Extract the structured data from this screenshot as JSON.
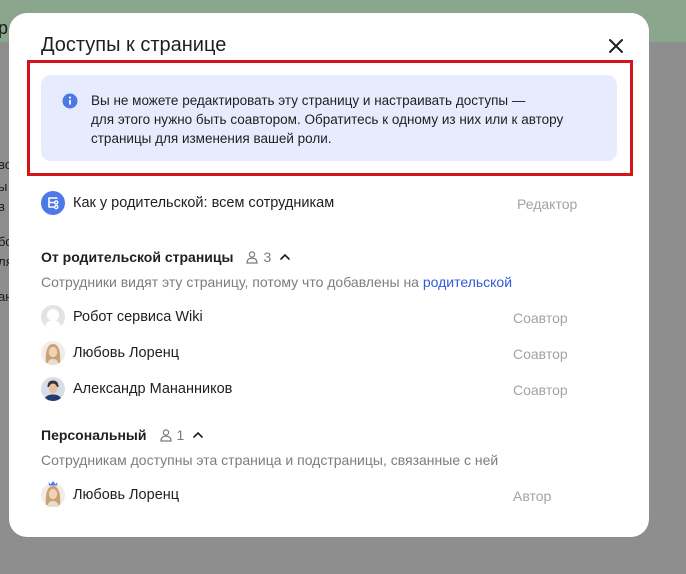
{
  "background": {
    "side_fragments": [
      "р",
      "во",
      "ы",
      "в",
      "бс",
      "ля",
      "ан"
    ]
  },
  "modal": {
    "title": "Доступы к странице",
    "notice": {
      "line1": "Вы не можете редактировать эту страницу и настраивать доступы —",
      "line2": "для этого нужно быть соавтором. Обратитесь к одному из них или к автору",
      "line3": "страницы для изменения вашей роли."
    },
    "inherit": {
      "label": "Как у родительской: всем сотрудникам",
      "role": "Редактор"
    },
    "parent_section": {
      "title": "От родительской страницы",
      "count": "3",
      "desc": "Сотрудники видят эту страницу, потому что добавлены на",
      "link": "родительской",
      "members": [
        {
          "name": "Робот сервиса Wiki",
          "role": "Соавтор",
          "avatar": "robot-avatar"
        },
        {
          "name": "Любовь Лоренц",
          "role": "Соавтор",
          "avatar": "woman-avatar"
        },
        {
          "name": "Александр Мананников",
          "role": "Соавтор",
          "avatar": "man-avatar"
        }
      ]
    },
    "personal_section": {
      "title": "Персональный",
      "count": "1",
      "desc": "Сотрудникам доступны эта страница и подстраницы, связанные с ней",
      "members": [
        {
          "name": "Любовь Лоренц",
          "role": "Автор",
          "avatar": "woman-avatar-crown"
        }
      ]
    }
  },
  "colors": {
    "accent": "#4c78e8",
    "notice_bg": "#e6ecfe",
    "highlight": "#d2151a",
    "muted": "#a3a3a3"
  }
}
